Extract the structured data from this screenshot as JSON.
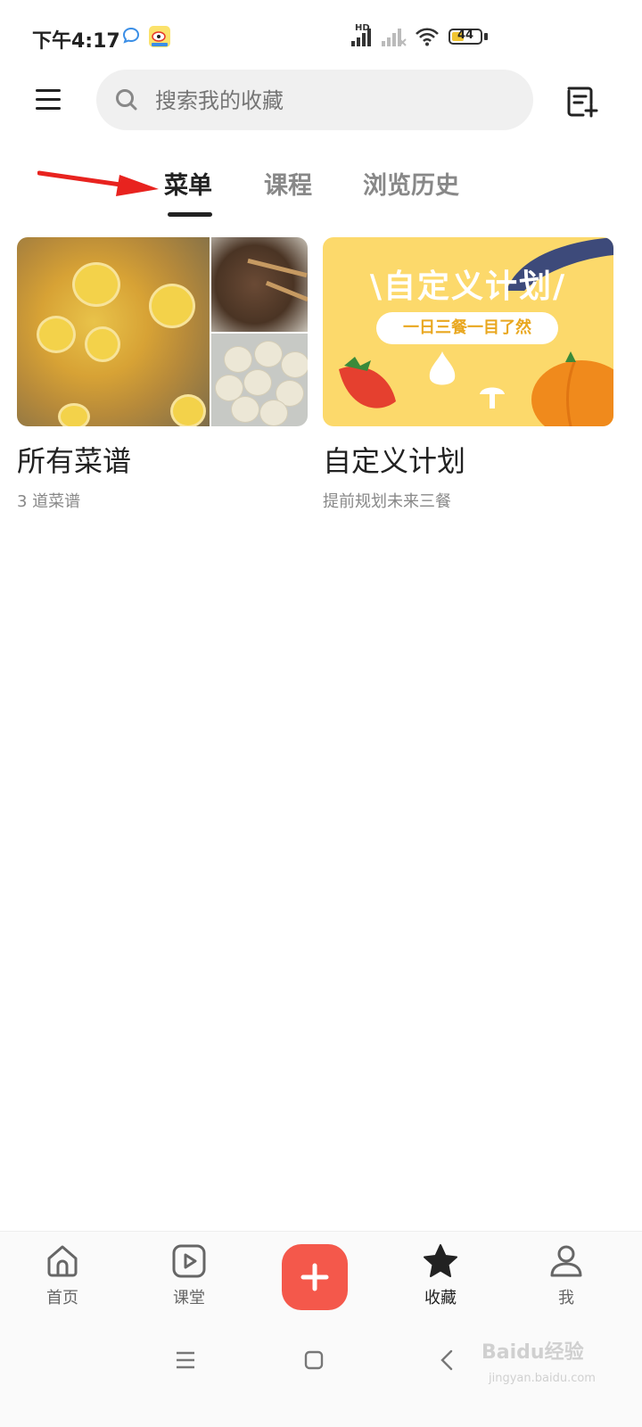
{
  "status_bar": {
    "time": "下午4:17",
    "network_label": "HD",
    "battery": "44",
    "battery_level": 0.44
  },
  "search": {
    "placeholder": "搜索我的收藏"
  },
  "tabs": [
    {
      "label": "菜单",
      "active": true
    },
    {
      "label": "课程",
      "active": false
    },
    {
      "label": "浏览历史",
      "active": false
    }
  ],
  "cards": [
    {
      "title": "所有菜谱",
      "subtitle": "3 道菜谱"
    },
    {
      "title": "自定义计划",
      "subtitle": "提前规划未来三餐",
      "banner_title": "\\自定义计划/",
      "banner_tagline": "一日三餐一目了然"
    }
  ],
  "bottom_nav": [
    {
      "label": "首页",
      "icon": "home-icon"
    },
    {
      "label": "课堂",
      "icon": "play-icon"
    },
    {
      "label": "",
      "icon": "plus-icon"
    },
    {
      "label": "收藏",
      "icon": "star-icon",
      "active": true
    },
    {
      "label": "我",
      "icon": "user-icon"
    }
  ],
  "watermark": {
    "text": "Baidu经验",
    "url": "jingyan.baidu.com"
  },
  "colors": {
    "accent": "#f4584b",
    "banner": "#fcd96b",
    "arrow": "#e8231f"
  }
}
